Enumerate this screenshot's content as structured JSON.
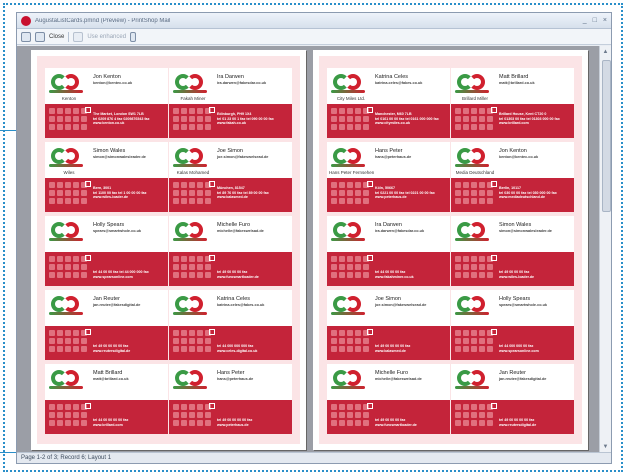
{
  "window": {
    "title": "AugustaListCards.pmnd (Preview) - PrintShop Mail",
    "controls": [
      "_",
      "□",
      "×"
    ]
  },
  "toolbar": {
    "close_label": "Close",
    "dim_label": "Use enhanced"
  },
  "status": {
    "text": "Page 1-2 of 3; Record 6; Layout 1"
  },
  "pages": [
    {
      "cards": [
        {
          "name": "Jon Kenton",
          "email": "kenton@kentec.co.uk",
          "company": "Kenton",
          "band": "The Market, London SW1 7LB\ntel 0209 876 4 fax 0209876543 fax\nwww.kenton.co.uk",
          "low": false
        },
        {
          "name": "Ira Darwen",
          "email": "ira.darwen@fakesdar.co.uk",
          "company": "Fakah Miner",
          "band": "Edinburgh, PH9 1X4\ntel 01 23 00 1 fax tel 090 00 00 fax\nwww.fakah.co.uk",
          "low": false
        },
        {
          "name": "Simon Wales",
          "email": "simon@simonwalesleader.de",
          "company": "Wiles",
          "band": "Bern, 3001\ntel 1100 00 fax tel 1 00 00 00 fax\nwww.wiles-loader.de",
          "low": false
        },
        {
          "name": "Joe Simon",
          "email": "joe.simon@fakeswelsead.de",
          "company": "Kalas Mohamed",
          "band": "München, 81547\ntel 89 76 00 fax tel 89 00 00 fax\nwww.kalasmed.de",
          "low": false
        },
        {
          "name": "Holly Spears",
          "email": "spears@smartwhole.co.uk",
          "company": "",
          "band": "tel 44 00 00 fax tel 44 000 000 fax\nwww.spearsonline.com",
          "low": true
        },
        {
          "name": "Michelle Furo",
          "email": "michelle@fakeswelsad.de",
          "company": "",
          "band": "tel 49 00 00 00 fax\nwww.furosmartloader.de",
          "low": true
        },
        {
          "name": "Jan Reuter",
          "email": "jan.reuter@fakesdigital.de",
          "company": "",
          "band": "tel 49 00 00 00 00 fax\nwww.reutersdigital.de",
          "low": true
        },
        {
          "name": "Katrina Celes",
          "email": "katrina.celes@fakes.co.uk",
          "company": "",
          "band": "tel 44 000 000 000 fax\nwww.celes-digital.co.uk",
          "low": true
        },
        {
          "name": "Matt Brillard",
          "email": "matt@brillard.co.uk",
          "company": "",
          "band": "tel 44 00 00 00 00 fax\nwww.brillard.com",
          "low": true
        },
        {
          "name": "Hans Peter",
          "email": "hans@peterhaus.de",
          "company": "",
          "band": "tel 49 00 00 00 00 fax\nwww.peterhaus.de",
          "low": true
        }
      ]
    },
    {
      "cards": [
        {
          "name": "Katrina Celes",
          "email": "katrina.celes@fakes.co.uk",
          "company": "City Miles Ltd.",
          "band": "Manchester, M60 7LB\ntel 0161 00 00 fax tel 0161 000 000 fax\nwww.citymiles.co.uk",
          "low": false
        },
        {
          "name": "Matt Brillard",
          "email": "matt@brillard.co.uk",
          "company": "Brillard Miller",
          "band": "Brillard House, Kent CT20 0\ntel 01303 00 fax tel 01303 000 00 fax\nwww.brillard.com",
          "low": false
        },
        {
          "name": "Hans Peter",
          "email": "hans@peterhaus.de",
          "company": "Hans Peter Fernsehen",
          "band": "Köln, 50667\ntel 0221 00 00 fax tel 0221 00 00 fax\nwww.peterhaus.de",
          "low": false
        },
        {
          "name": "Jon Kenton",
          "email": "kenton@kentec.co.uk",
          "company": "Media Deutschland",
          "band": "Berlin, 10117\ntel 030 00 00 fax tel 030 000 00 fax\nwww.mediadeutschland.de",
          "low": false
        },
        {
          "name": "Ira Darwen",
          "email": "ira.darwen@fakesdar.co.uk",
          "company": "",
          "band": "tel 44 00 00 00 fax\nwww.fakahminer.co.uk",
          "low": true
        },
        {
          "name": "Simon Wales",
          "email": "simon@simonwalesleader.de",
          "company": "",
          "band": "tel 49 00 00 00 fax\nwww.wiles-loader.de",
          "low": true
        },
        {
          "name": "Joe Simon",
          "email": "joe.simon@fakeswelsead.de",
          "company": "",
          "band": "tel 49 00 00 00 00 fax\nwww.kalasmed.de",
          "low": true
        },
        {
          "name": "Holly Spears",
          "email": "spears@smartwhole.co.uk",
          "company": "",
          "band": "tel 44 000 000 00 fax\nwww.spearsonline.com",
          "low": true
        },
        {
          "name": "Michelle Furo",
          "email": "michelle@fakeswelsad.de",
          "company": "",
          "band": "tel 49 00 00 00 fax\nwww.furosmartloader.de",
          "low": true
        },
        {
          "name": "Jan Reuter",
          "email": "jan.reuter@fakesdigital.de",
          "company": "",
          "band": "tel 49 00 00 00 00 fax\nwww.reutersdigital.de",
          "low": true
        }
      ]
    }
  ]
}
